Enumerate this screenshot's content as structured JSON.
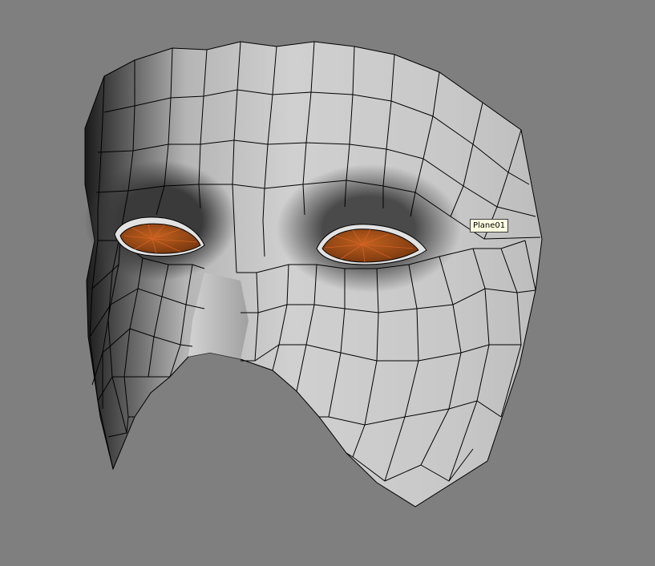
{
  "viewport": {
    "background_color": "#7f7f7f",
    "tooltip": {
      "object_name": "Plane01"
    }
  },
  "model": {
    "skin_color": "#c9c9c9",
    "wire_color": "#000000",
    "eye_color": "#a24a14",
    "eye_wire_color": "#e0642a"
  }
}
